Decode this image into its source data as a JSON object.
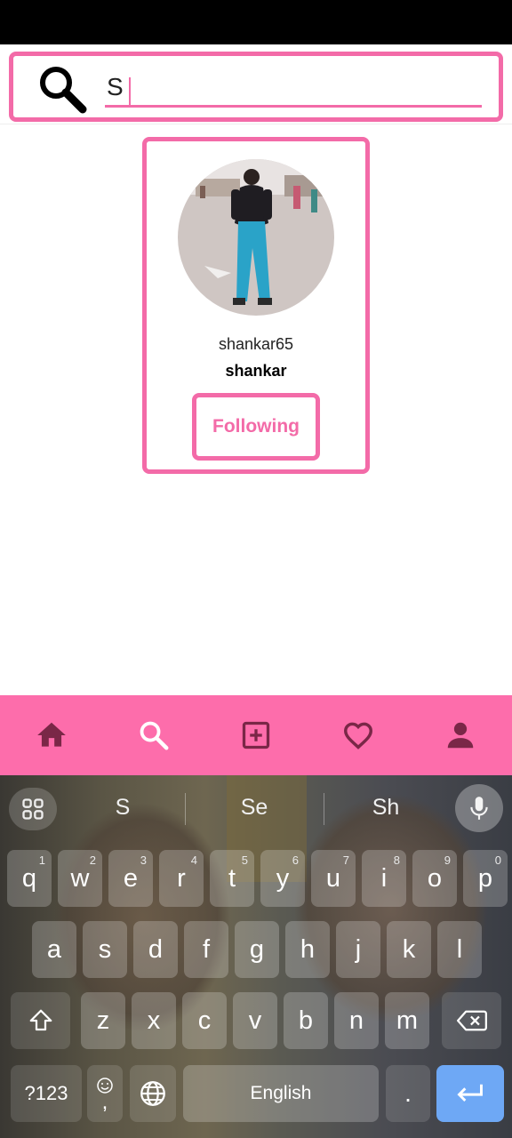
{
  "search": {
    "value": "S",
    "icon": "search-icon"
  },
  "result": {
    "username": "shankar65",
    "fullname": "shankar",
    "follow_label": "Following"
  },
  "nav": [
    {
      "name": "home-icon"
    },
    {
      "name": "search-icon"
    },
    {
      "name": "add-post-icon"
    },
    {
      "name": "heart-icon"
    },
    {
      "name": "profile-icon"
    }
  ],
  "keyboard": {
    "suggestions": [
      "S",
      "Se",
      "Sh"
    ],
    "row1": [
      {
        "k": "q",
        "h": "1"
      },
      {
        "k": "w",
        "h": "2"
      },
      {
        "k": "e",
        "h": "3"
      },
      {
        "k": "r",
        "h": "4"
      },
      {
        "k": "t",
        "h": "5"
      },
      {
        "k": "y",
        "h": "6"
      },
      {
        "k": "u",
        "h": "7"
      },
      {
        "k": "i",
        "h": "8"
      },
      {
        "k": "o",
        "h": "9"
      },
      {
        "k": "p",
        "h": "0"
      }
    ],
    "row2": [
      "a",
      "s",
      "d",
      "f",
      "g",
      "h",
      "j",
      "k",
      "l"
    ],
    "row3": [
      "z",
      "x",
      "c",
      "v",
      "b",
      "n",
      "m"
    ],
    "symbols_label": "?123",
    "comma": ",",
    "space_label": "English",
    "period": "."
  },
  "colors": {
    "accent": "#f36ba8",
    "nav_bg": "#fd6dab",
    "nav_icon": "#7a2747",
    "nav_active": "#ffffff"
  }
}
